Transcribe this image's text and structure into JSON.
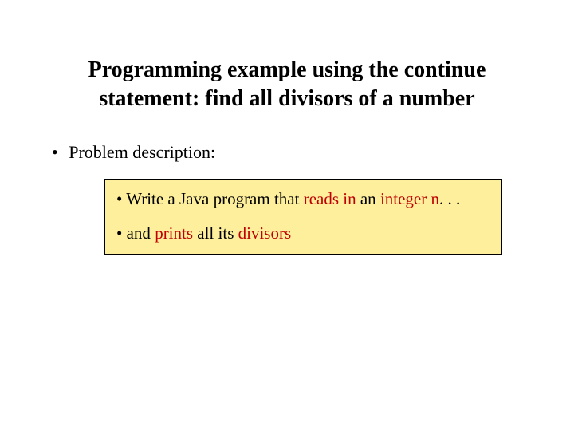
{
  "title": "Programming example using the continue statement: find all divisors of a number",
  "bullet": "Problem description:",
  "box": {
    "line1": {
      "prefix": "• Write a Java program that ",
      "red1": "reads in",
      "mid": " an ",
      "red2": "integer n",
      "suffix": ". . ."
    },
    "line2": {
      "prefix": "• and ",
      "red1": "prints",
      "mid": " all its ",
      "red2": "divisors"
    }
  }
}
